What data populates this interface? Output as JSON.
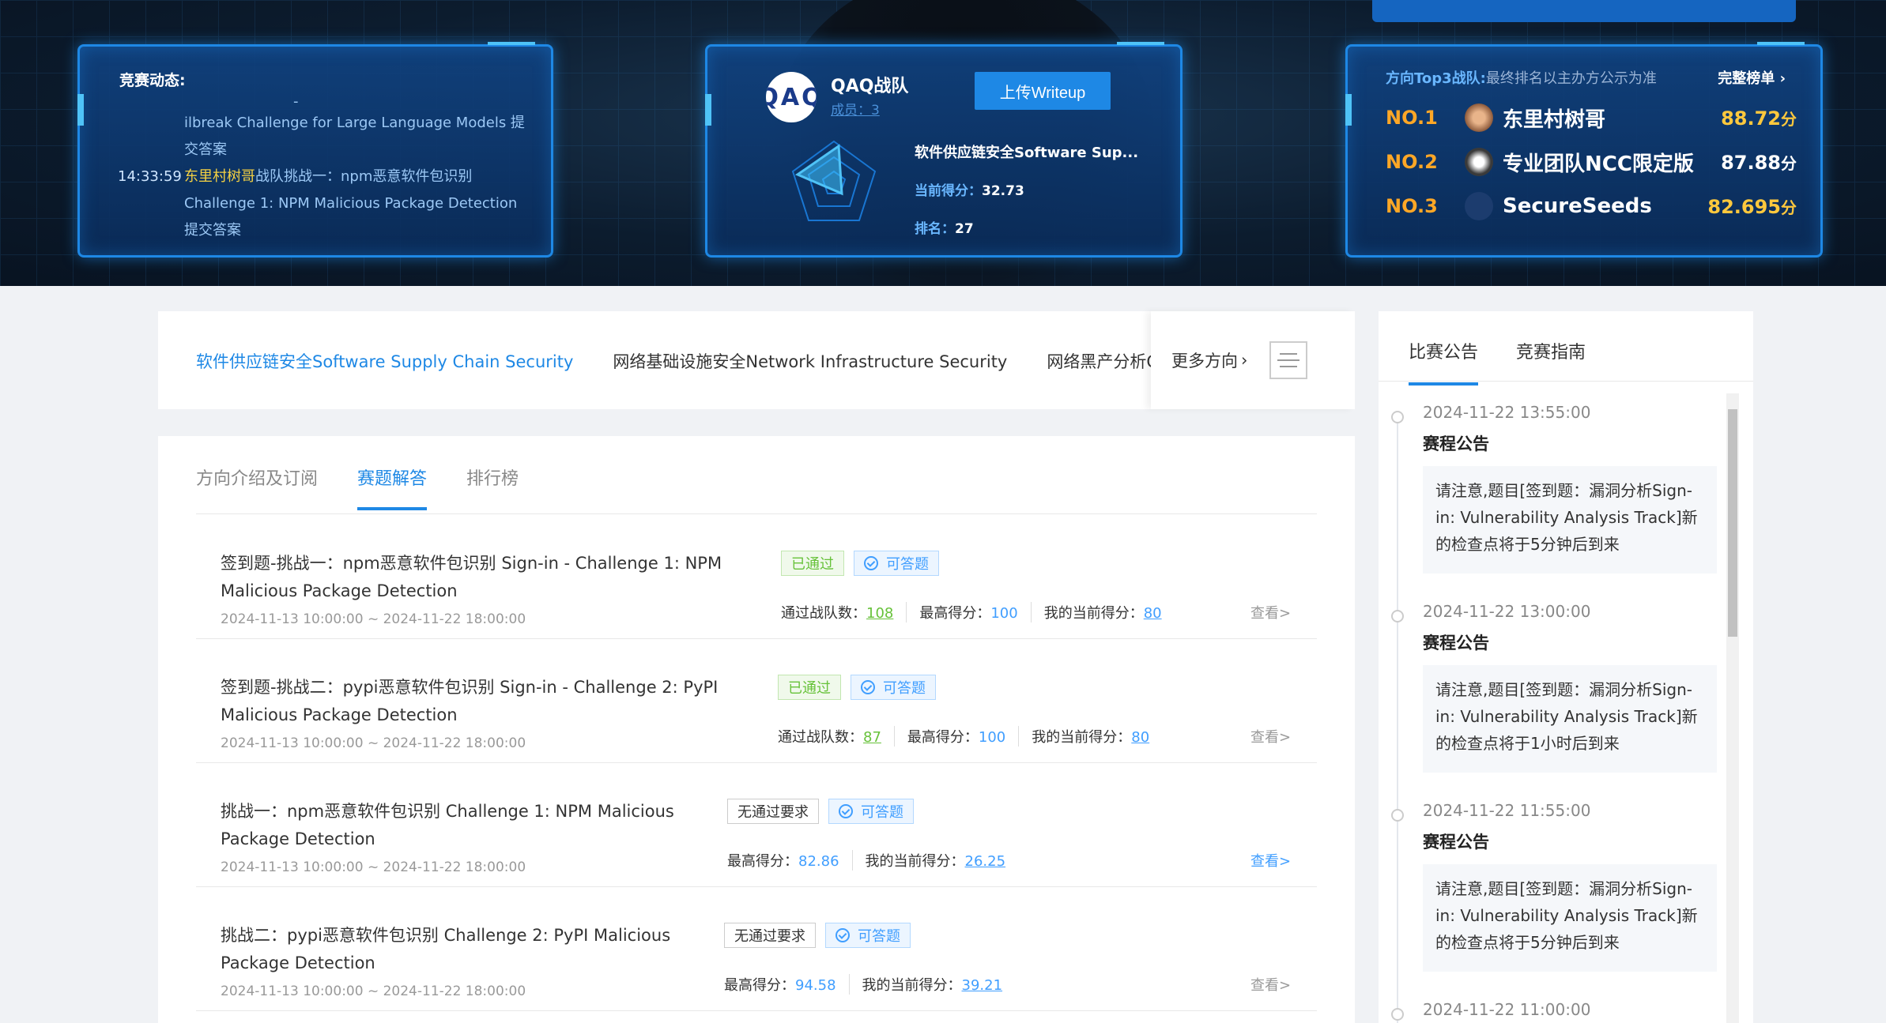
{
  "hero": {
    "feed": {
      "title": "竞赛动态:",
      "dash": "-",
      "items": [
        {
          "time": "",
          "team": "",
          "text": "ilbreak Challenge for Large Language Models 提交答案"
        },
        {
          "time": "14:33:59",
          "team": "东里村树哥",
          "team_suffix": "战队挑战一：npm恶意软件包识别Challenge 1: NPM Malicious Package Detection 提交答案"
        }
      ]
    },
    "team": {
      "avatar_text": "QAQ",
      "name": "QAQ战队",
      "members": "成员：3",
      "upload_label": "上传Writeup",
      "direction": "软件供应链安全Software Sup...",
      "score_label": "当前得分：",
      "score": "32.73",
      "rank_label": "排名：",
      "rank": "27"
    },
    "top3": {
      "title": "方向Top3战队:",
      "note": "最终排名以主办方公示为准",
      "full_list": "完整榜单",
      "unit": "分",
      "rows": [
        {
          "no": "NO.1",
          "name": "东里村树哥",
          "score": "88.72"
        },
        {
          "no": "NO.2",
          "name": "专业团队NCC限定版",
          "score": "87.88"
        },
        {
          "no": "NO.3",
          "name": "SecureSeeds",
          "score": "82.695"
        }
      ]
    }
  },
  "directions": {
    "tabs": [
      "软件供应链安全Software Supply Chain Security",
      "网络基础设施安全Network Infrastructure Security",
      "网络黑产分析Cyber Crime Analysis"
    ],
    "more": "更多方向"
  },
  "main": {
    "tabs": [
      "方向介绍及订阅",
      "赛题解答",
      "排行榜"
    ],
    "challenges": [
      {
        "title": "签到题-挑战一：npm恶意软件包识别 Sign-in - Challenge 1: NPM Malicious Package Detection",
        "date": "2024-11-13 10:00:00 ~ 2024-11-22 18:00:00",
        "tag1": "已通过",
        "tag2": "可答题",
        "s1_label": "通过战队数：",
        "s1": "108",
        "s2_label": "最高得分：",
        "s2": "100",
        "s3_label": "我的当前得分：",
        "s3": "80",
        "view": "查看>"
      },
      {
        "title": "签到题-挑战二：pypi恶意软件包识别 Sign-in - Challenge 2: PyPI Malicious Package Detection",
        "date": "2024-11-13 10:00:00 ~ 2024-11-22 18:00:00",
        "tag1": "已通过",
        "tag2": "可答题",
        "s1_label": "通过战队数：",
        "s1": "87",
        "s2_label": "最高得分：",
        "s2": "100",
        "s3_label": "我的当前得分：",
        "s3": "80",
        "view": "查看>"
      },
      {
        "title": "挑战一：npm恶意软件包识别 Challenge 1: NPM Malicious Package Detection",
        "date": "2024-11-13 10:00:00 ~ 2024-11-22 18:00:00",
        "tag1": "无通过要求",
        "tag2": "可答题",
        "s2_label": "最高得分：",
        "s2": "82.86",
        "s3_label": "我的当前得分：",
        "s3": "26.25",
        "view": "查看>"
      },
      {
        "title": "挑战二：pypi恶意软件包识别 Challenge 2: PyPI Malicious Package Detection",
        "date": "2024-11-13 10:00:00 ~ 2024-11-22 18:00:00",
        "tag1": "无通过要求",
        "tag2": "可答题",
        "s2_label": "最高得分：",
        "s2": "94.58",
        "s3_label": "我的当前得分：",
        "s3": "39.21",
        "view": "查看>"
      }
    ]
  },
  "notice": {
    "tabs": [
      "比赛公告",
      "竞赛指南"
    ],
    "items": [
      {
        "date": "2024-11-22 13:55:00",
        "title": "赛程公告",
        "body": "请注意,题目[签到题：漏洞分析Sign-in: Vulnerability Analysis Track]新的检查点将于5分钟后到来"
      },
      {
        "date": "2024-11-22 13:00:00",
        "title": "赛程公告",
        "body": "请注意,题目[签到题：漏洞分析Sign-in: Vulnerability Analysis Track]新的检查点将于1小时后到来"
      },
      {
        "date": "2024-11-22 11:55:00",
        "title": "赛程公告",
        "body": "请注意,题目[签到题：漏洞分析Sign-in: Vulnerability Analysis Track]新的检查点将于5分钟后到来"
      },
      {
        "date": "2024-11-22 11:00:00",
        "title": "",
        "body": ""
      }
    ]
  },
  "colors": {
    "accent": "#1e88e5",
    "pass": "#67c23a",
    "gold": "#ffc83d",
    "rank_no": "#ffa726"
  }
}
